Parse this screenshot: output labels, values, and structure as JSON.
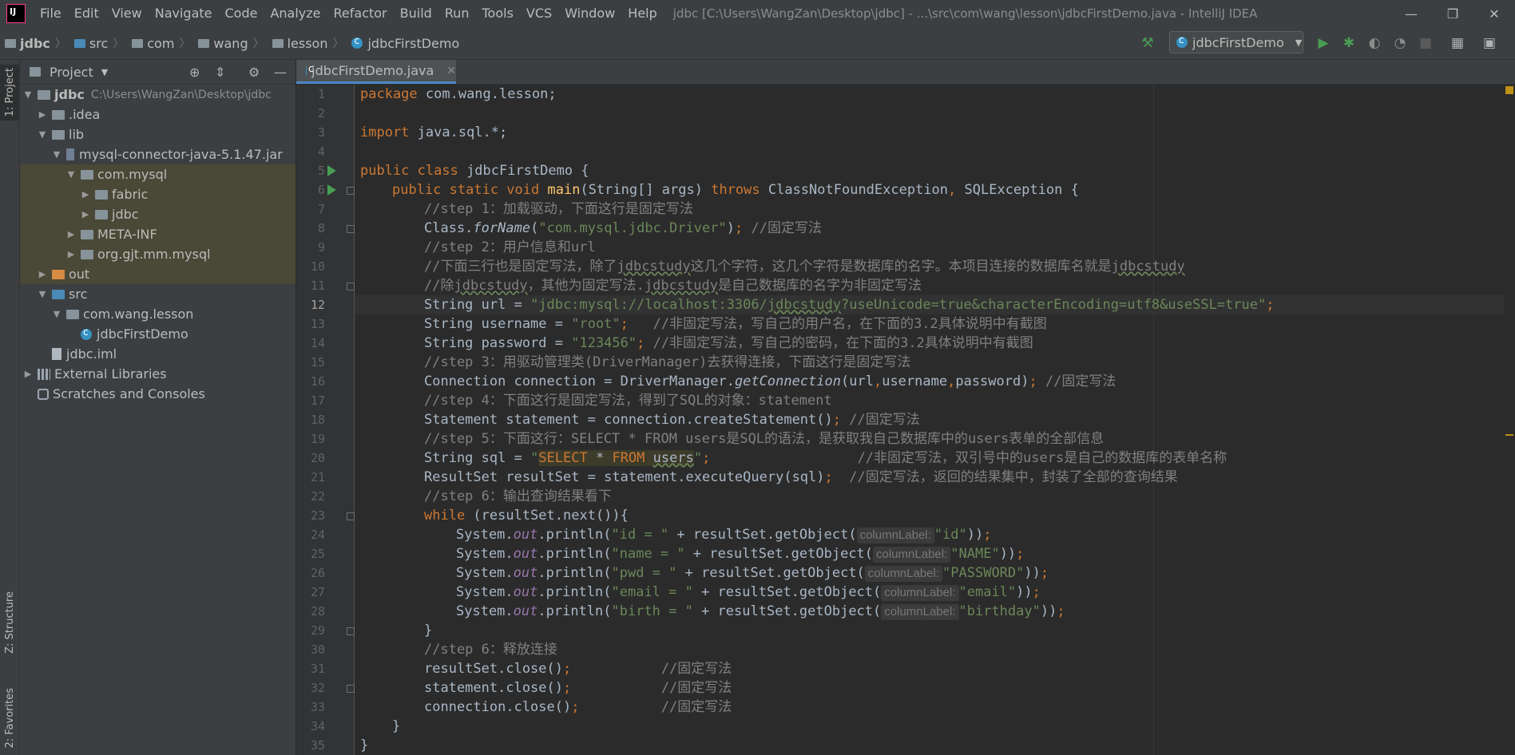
{
  "menubar": {
    "items": [
      "File",
      "Edit",
      "View",
      "Navigate",
      "Code",
      "Analyze",
      "Refactor",
      "Build",
      "Run",
      "Tools",
      "VCS",
      "Window",
      "Help"
    ],
    "title": "jdbc [C:\\Users\\WangZan\\Desktop\\jdbc] - ...\\src\\com\\wang\\lesson\\jdbcFirstDemo.java - IntelliJ IDEA",
    "minimize": "—",
    "restore": "❐",
    "close": "✕"
  },
  "breadcrumb": [
    "jdbc",
    "src",
    "com",
    "wang",
    "lesson",
    "jdbcFirstDemo"
  ],
  "run_config": "jdbcFirstDemo",
  "left_tabs": {
    "project": "1: Project",
    "structure": "Z: Structure",
    "favorites": "2: Favorites"
  },
  "project_panel": {
    "title": "Project",
    "tree": [
      {
        "label": "jdbc",
        "hint": "C:\\Users\\WangZan\\Desktop\\jdbc"
      },
      {
        "label": ".idea"
      },
      {
        "label": "lib"
      },
      {
        "label": "mysql-connector-java-5.1.47.jar"
      },
      {
        "label": "com.mysql"
      },
      {
        "label": "fabric"
      },
      {
        "label": "jdbc"
      },
      {
        "label": "META-INF"
      },
      {
        "label": "org.gjt.mm.mysql"
      },
      {
        "label": "out"
      },
      {
        "label": "src"
      },
      {
        "label": "com.wang.lesson"
      },
      {
        "label": "jdbcFirstDemo"
      },
      {
        "label": "jdbc.iml"
      },
      {
        "label": "External Libraries"
      },
      {
        "label": "Scratches and Consoles"
      }
    ]
  },
  "editor": {
    "tab_label": "jdbcFirstDemo.java",
    "current_line": 12,
    "line_numbers": [
      "1",
      "2",
      "3",
      "4",
      "5",
      "6",
      "7",
      "8",
      "9",
      "10",
      "11",
      "12",
      "13",
      "14",
      "15",
      "16",
      "17",
      "18",
      "19",
      "20",
      "21",
      "22",
      "23",
      "24",
      "25",
      "26",
      "27",
      "28",
      "29",
      "30",
      "31",
      "32",
      "33",
      "34",
      "35"
    ],
    "code": {
      "l1_kw": "package",
      "l1_rest": " com.wang.lesson;",
      "l3_kw": "import",
      "l3_rest": " java.sql.*;",
      "l5_kw": "public class",
      "l5_rest": " jdbcFirstDemo {",
      "l6_kw1": "public static void",
      "l6_fn": "main",
      "l6_mid": "(String[] args) ",
      "l6_kw2": "throws",
      "l6_rest": " ClassNotFoundException",
      "l6_comma": ",",
      "l6_rest2": " SQLException {",
      "l7": "//step 1：加载驱动，下面这行是固定写法",
      "l8_a": "Class.",
      "l8_fn": "forName",
      "l8_b": "(",
      "l8_str": "\"com.mysql.jdbc.Driver\"",
      "l8_c": ")",
      "l8_semi": ";",
      "l8_com": " //固定写法",
      "l9": "//step 2：用户信息和url",
      "l10_a": "//下面三行也是固定写法，除了",
      "l10_u1": "jdbcstudy",
      "l10_b": "这几个字符，这几个字符是数据库的名字。本项目连接的数据库名就是",
      "l10_u2": "jdbcstudy",
      "l11_a": "//除",
      "l11_u1": "jdbcstudy",
      "l11_b": "，其他为固定写法.",
      "l11_u2": "jdbcstudy",
      "l11_c": "是自己数据库的名字为非固定写法",
      "l12_a": "String url = ",
      "l12_str1": "\"jdbc:mysql://localhost:3306/",
      "l12_u": "jdbcstudy",
      "l12_str2": "?useUnicode=true&characterEncoding=utf8&useSSL=true\"",
      "l12_semi": ";",
      "l13_a": "String username = ",
      "l13_str": "\"root\"",
      "l13_semi": ";",
      "l13_com": "   //非固定写法，写自己的用户名，在下面的3.2具体说明中有截图",
      "l14_a": "String password = ",
      "l14_str": "\"123456\"",
      "l14_semi": ";",
      "l14_com": " //非固定写法，写自己的密码，在下面的3.2具体说明中有截图",
      "l15": "//step 3：用驱动管理类(DriverManager)去获得连接，下面这行是固定写法",
      "l16_a": "Connection connection = DriverManager.",
      "l16_fn": "getConnection",
      "l16_b": "(url",
      "l16_c1": ",",
      "l16_c": "username",
      "l16_c2": ",",
      "l16_d": "password)",
      "l16_semi": ";",
      "l16_com": " //固定写法",
      "l17": "//step 4：下面这行是固定写法，得到了SQL的对象：statement",
      "l18_a": "Statement statement = connection.createStatement()",
      "l18_semi": ";",
      "l18_com": " //固定写法",
      "l19": "//step 5：下面这行：SELECT * FROM users是SQL的语法，是获取我自己数据库中的users表单的全部信息",
      "l20_a": "String sql = ",
      "l20_q1": "\"",
      "l20_sel": "SELECT",
      "l20_star": " * ",
      "l20_from": "FROM",
      "l20_sp": " ",
      "l20_users": "users",
      "l20_q2": "\"",
      "l20_semi": ";",
      "l20_com": "                  //非固定写法，双引号中的users是自己的数据库的表单名称",
      "l21_a": "ResultSet resultSet = statement.executeQuery(sql)",
      "l21_semi": ";",
      "l21_com": "  //固定写法，返回的结果集中，封装了全部的查询结果",
      "l22": "//step 6：输出查询结果看下",
      "l23_kw": "while",
      "l23_rest": " (resultSet.next()){",
      "sys": "System.",
      "out": "out",
      "println": ".println(",
      "l24_str": "\"id = \"",
      "l25_str": "\"name = \"",
      "l26_str": "\"pwd = \"",
      "l27_str": "\"email = \"",
      "l28_str": "\"birth = \"",
      "getobj": " + resultSet.getObject(",
      "hint": "columnLabel:",
      "l24_arg": "\"id\"",
      "l25_arg": "\"NAME\"",
      "l26_arg": "\"PASSWORD\"",
      "l27_arg": "\"email\"",
      "l28_arg": "\"birthday\"",
      "close_call": "))",
      "semi": ";",
      "l29": "}",
      "l30": "//step 6：释放连接",
      "l31_a": "resultSet.close()",
      "l32_a": "statement.close()",
      "l33_a": "connection.close()",
      "l31_com": "           //固定写法",
      "l32_com": "           //固定写法",
      "l33_com": "          //固定写法",
      "l34": "}",
      "l35": "}"
    }
  },
  "colors": {
    "keyword": "#cc7832",
    "string": "#6a8759",
    "comment": "#808080",
    "method": "#ffc66d",
    "field": "#9876aa",
    "run": "#499c54",
    "highlight_row": "#4a4836"
  }
}
